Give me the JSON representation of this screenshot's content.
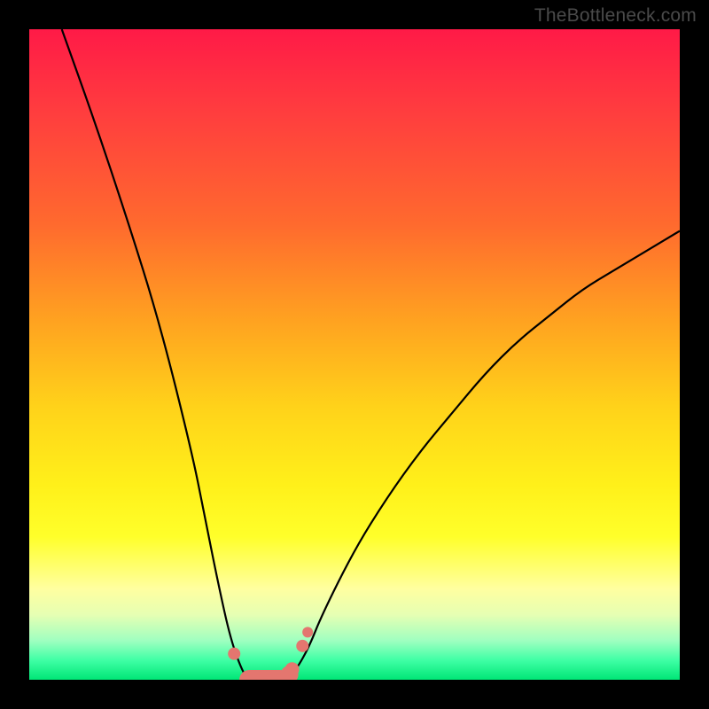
{
  "watermark": "TheBottleneck.com",
  "colors": {
    "frame": "#000000",
    "curve": "#000000",
    "marker": "#e4766f",
    "gradient_top": "#ff1a47",
    "gradient_bottom": "#00e676"
  },
  "chart_data": {
    "type": "line",
    "title": "",
    "xlabel": "",
    "ylabel": "",
    "xlim": [
      0,
      100
    ],
    "ylim": [
      0,
      100
    ],
    "grid": false,
    "x": [
      5,
      10,
      15,
      20,
      25,
      27,
      29,
      31,
      33,
      34,
      35,
      36,
      37,
      38,
      39,
      40,
      41,
      43,
      45,
      50,
      55,
      60,
      65,
      70,
      75,
      80,
      85,
      90,
      95,
      100
    ],
    "y": [
      100,
      86,
      71,
      55,
      35,
      25,
      15,
      6,
      0.7,
      0,
      0,
      0,
      0,
      0,
      0,
      0.7,
      1.5,
      5,
      10,
      20,
      28,
      35,
      41,
      47,
      52,
      56,
      60,
      63,
      66,
      69
    ],
    "markers": {
      "x": [
        31.5,
        33.8,
        34.5,
        35.5,
        36.5,
        37.5,
        38.5,
        40.0,
        40.4,
        42.0,
        42.8
      ],
      "y": [
        4.0,
        0.0,
        0.0,
        0.0,
        0.0,
        0.0,
        0.0,
        0.8,
        1.6,
        5.2,
        7.3
      ]
    }
  }
}
